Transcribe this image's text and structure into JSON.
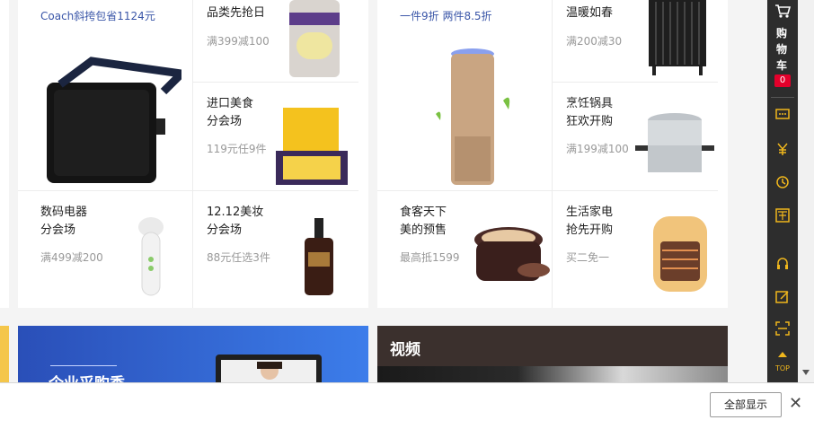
{
  "left_panel": {
    "big_item": {
      "subtitle": "Coach斜挎包省1124元"
    },
    "items": [
      {
        "title_line1": "品类先抢日",
        "title_line2": "",
        "promo": "满399减100"
      },
      {
        "title_line1": "进口美食",
        "title_line2": "分会场",
        "promo": "119元任9件"
      },
      {
        "title_line1": "数码电器",
        "title_line2": "分会场",
        "promo": "满499减200"
      },
      {
        "title_line1": "12.12美妆",
        "title_line2": "分会场",
        "promo": "88元任选3件"
      }
    ]
  },
  "right_panel": {
    "big_item": {
      "subtitle": "一件9折 两件8.5折"
    },
    "items": [
      {
        "title_line1": "温暖如春",
        "title_line2": "",
        "promo": "满200减30"
      },
      {
        "title_line1": "烹饪锅具",
        "title_line2": "狂欢开购",
        "promo": "满199减100"
      },
      {
        "title_line1": "食客天下",
        "title_line2": "美的预售",
        "promo": "最高抵1599"
      },
      {
        "title_line1": "生活家电",
        "title_line2": "抢先开购",
        "promo": "买二免一"
      }
    ]
  },
  "banners": {
    "enterprise_title": "企业采购季",
    "video_title": "视频"
  },
  "sidebar": {
    "cart_label_1": "购",
    "cart_label_2": "物",
    "cart_label_3": "车",
    "cart_count": "0",
    "top_label": "TOP"
  },
  "bottom_bar": {
    "show_all_label": "全部显示",
    "close_symbol": "✕"
  },
  "colors": {
    "accent_blue": "#3a56a8",
    "sidebar_bg": "#2d2d2d",
    "sidebar_icon": "#f0b71d",
    "badge_red": "#e4002b"
  }
}
